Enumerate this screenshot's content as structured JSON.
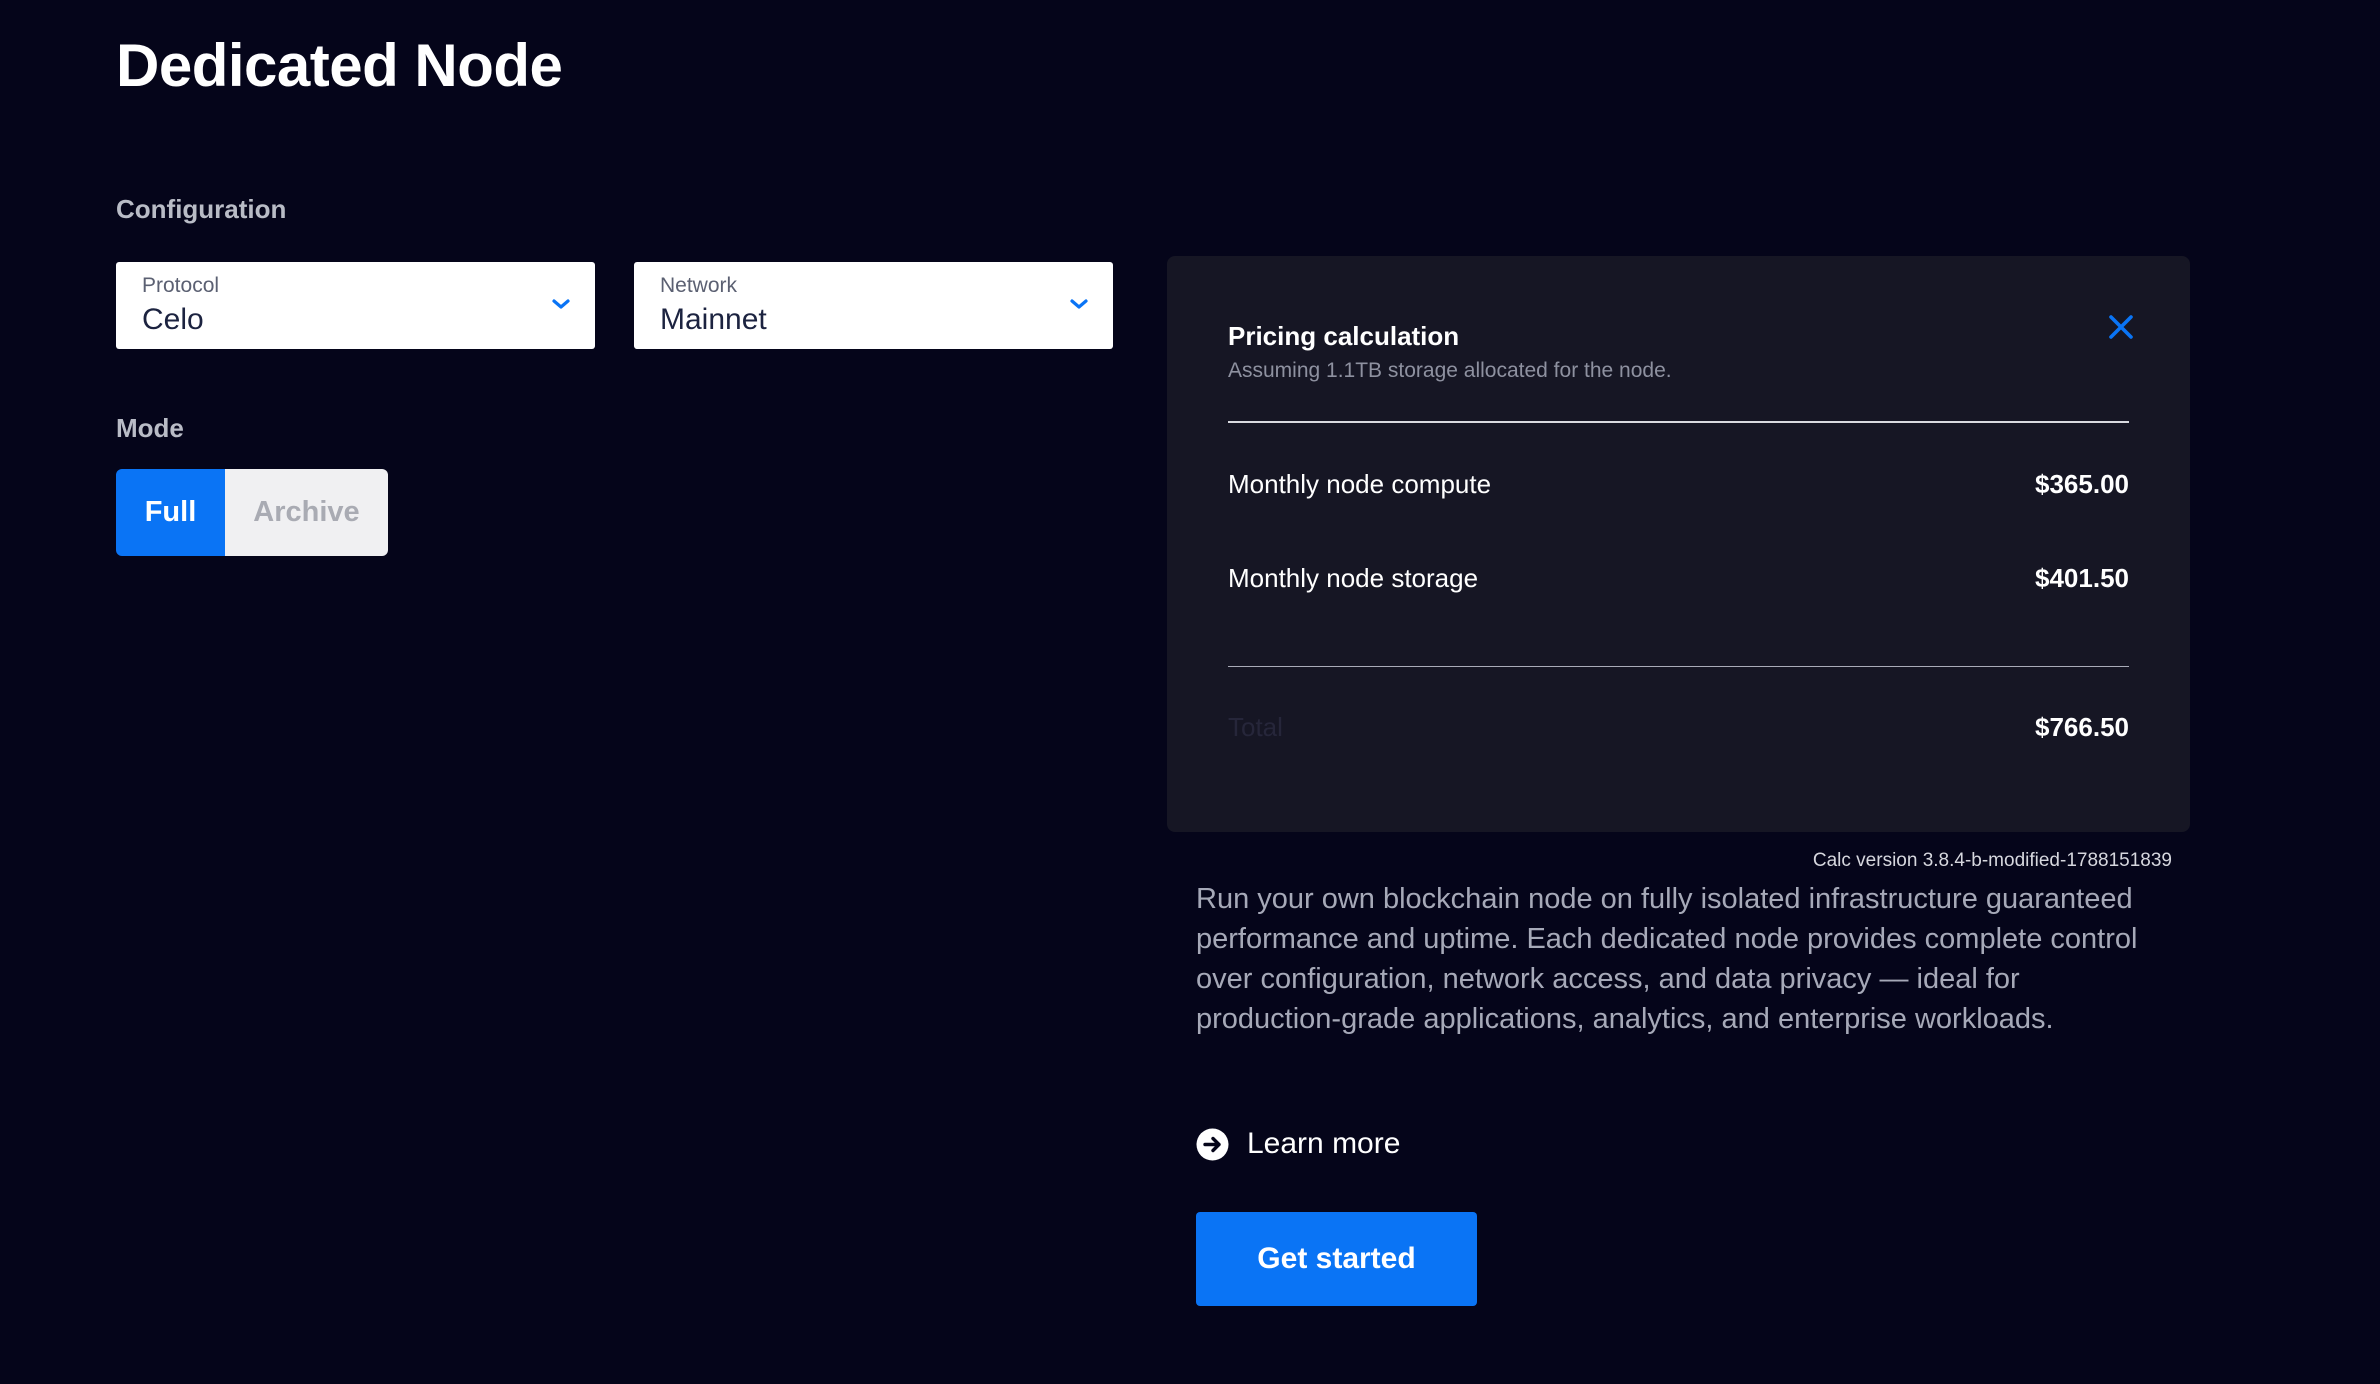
{
  "page": {
    "title": "Dedicated Node"
  },
  "configuration": {
    "section_label": "Configuration",
    "protocol": {
      "caption": "Protocol",
      "value": "Celo",
      "icon": "chevron-down-icon"
    },
    "network": {
      "caption": "Network",
      "value": "Mainnet",
      "icon": "chevron-down-icon"
    }
  },
  "mode": {
    "section_label": "Mode",
    "options": [
      "Full",
      "Archive"
    ],
    "selected": "Full"
  },
  "pricing": {
    "title": "Pricing calculation",
    "subtitle": "Assuming 1.1TB storage allocated for the node.",
    "close_icon": "close-icon",
    "rows": [
      {
        "label": "Monthly node compute",
        "value": "$365.00"
      },
      {
        "label": "Monthly node storage",
        "value": "$401.50"
      }
    ],
    "total": {
      "label": "Total",
      "value": "$766.50"
    }
  },
  "calc_version": "Calc version 3.8.4-b-modified-1788151839",
  "description": "Run your own blockchain node on fully isolated infrastructure guaranteed performance and uptime. Each dedicated node provides complete control over configuration, network access, and data privacy — ideal for production-grade applications, analytics, and enterprise workloads.",
  "learn_more": {
    "label": "Learn more",
    "icon": "arrow-circle-right-icon"
  },
  "cta": {
    "label": "Get started"
  },
  "colors": {
    "background": "#05051a",
    "accent": "#0a74f5",
    "card": "#161624"
  }
}
